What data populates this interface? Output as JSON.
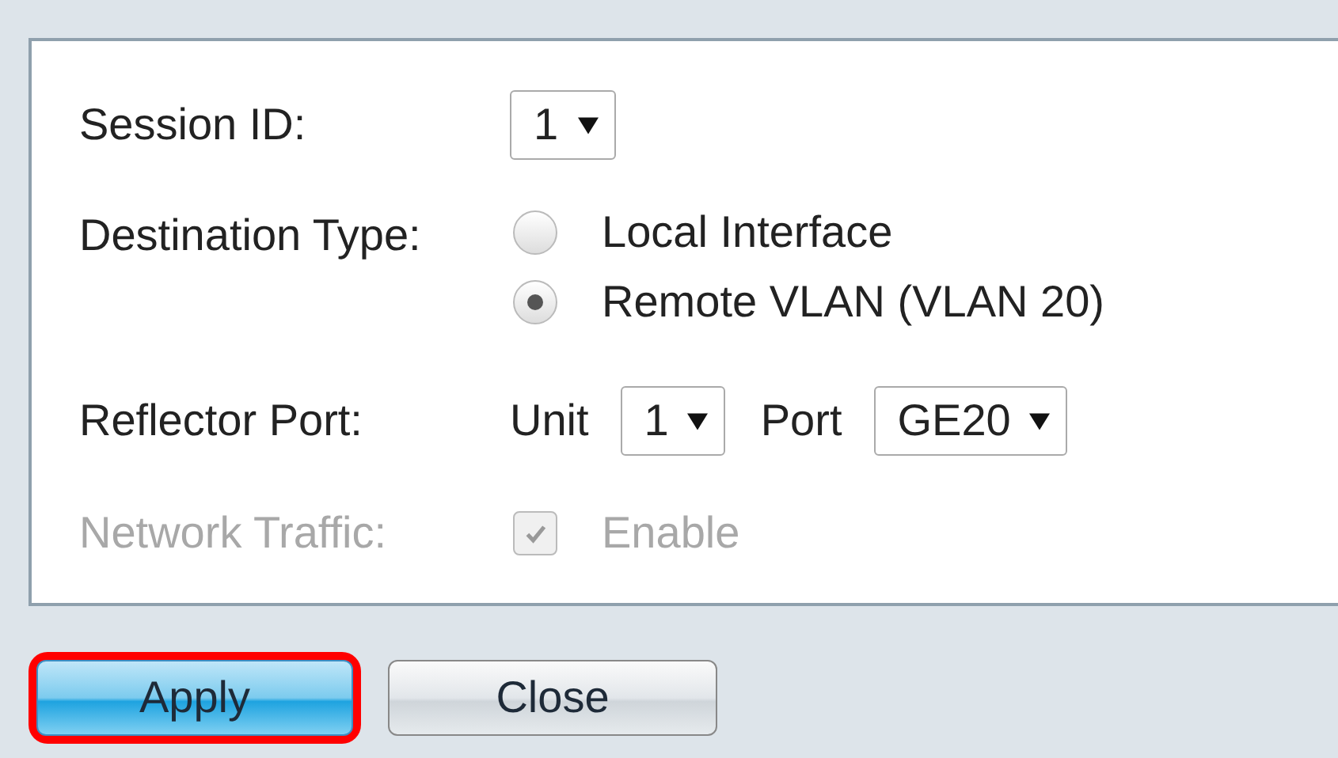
{
  "session_id": {
    "label": "Session ID:",
    "value": "1"
  },
  "destination_type": {
    "label": "Destination Type:",
    "options": [
      {
        "label": "Local Interface",
        "selected": false
      },
      {
        "label": "Remote VLAN (VLAN 20)",
        "selected": true
      }
    ]
  },
  "reflector_port": {
    "label": "Reflector Port:",
    "unit_label": "Unit",
    "unit_value": "1",
    "port_label": "Port",
    "port_value": "GE20"
  },
  "network_traffic": {
    "label": "Network Traffic:",
    "option": "Enable",
    "checked": true,
    "disabled": true
  },
  "buttons": [
    {
      "label": "Apply",
      "kind": "primary",
      "highlighted": true
    },
    {
      "label": "Close",
      "kind": "secondary",
      "highlighted": false
    }
  ]
}
